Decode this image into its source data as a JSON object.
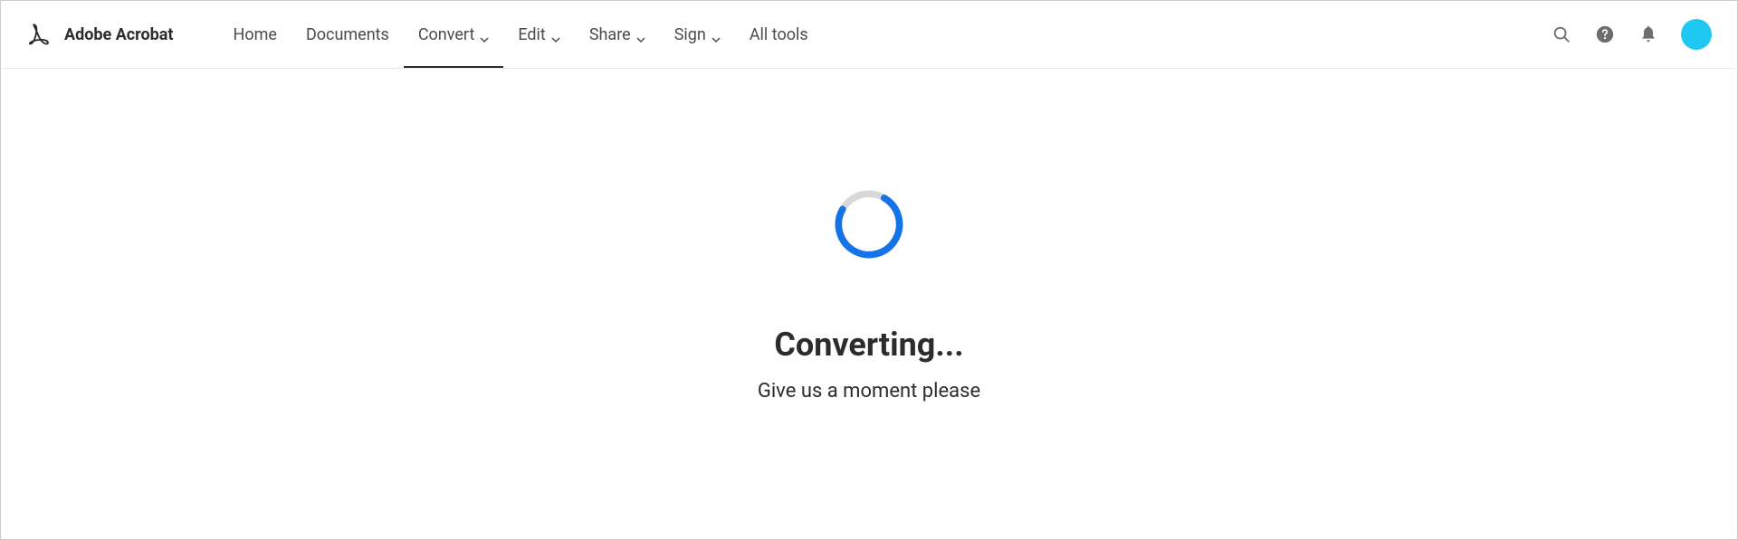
{
  "header": {
    "product_name": "Adobe Acrobat",
    "nav": [
      {
        "label": "Home",
        "dropdown": false,
        "active": false
      },
      {
        "label": "Documents",
        "dropdown": false,
        "active": false
      },
      {
        "label": "Convert",
        "dropdown": true,
        "active": true
      },
      {
        "label": "Edit",
        "dropdown": true,
        "active": false
      },
      {
        "label": "Share",
        "dropdown": true,
        "active": false
      },
      {
        "label": "Sign",
        "dropdown": true,
        "active": false
      },
      {
        "label": "All tools",
        "dropdown": false,
        "active": false
      }
    ]
  },
  "main": {
    "status_title": "Converting...",
    "status_subtitle": "Give us a moment please"
  },
  "colors": {
    "spinner_accent": "#1473e6",
    "spinner_track": "#d3d3d3",
    "avatar": "#1fc8f0"
  }
}
